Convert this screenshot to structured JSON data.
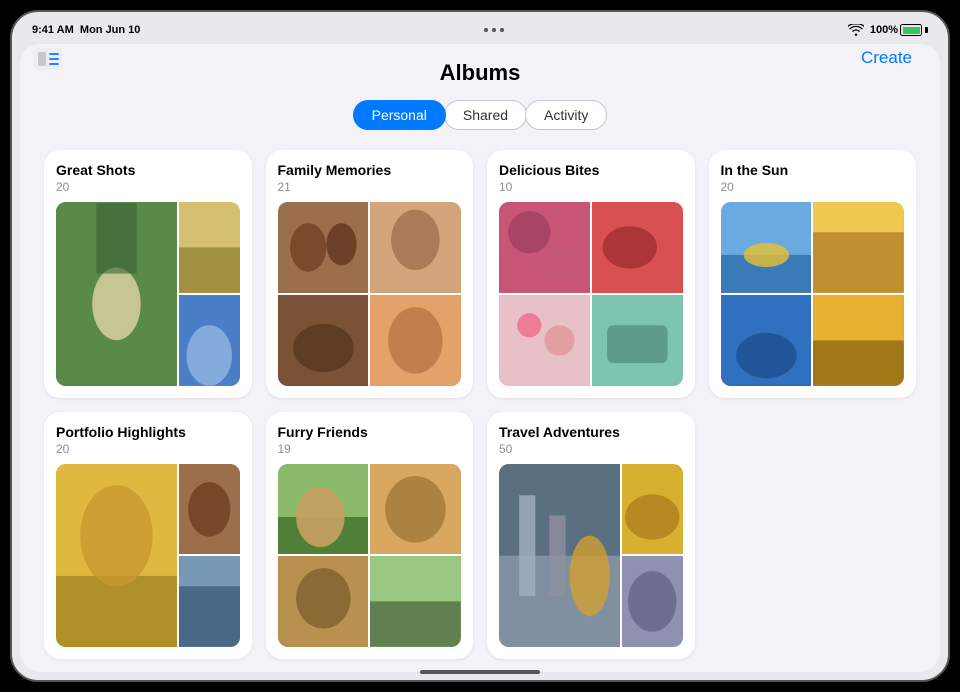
{
  "statusBar": {
    "time": "9:41 AM",
    "date": "Mon Jun 10",
    "battery": "100%"
  },
  "header": {
    "title": "Albums",
    "createLabel": "Create"
  },
  "tabs": [
    {
      "id": "personal",
      "label": "Personal",
      "active": true
    },
    {
      "id": "shared",
      "label": "Shared",
      "active": false
    },
    {
      "id": "activity",
      "label": "Activity",
      "active": false
    }
  ],
  "albums": [
    {
      "title": "Great Shots",
      "count": "20",
      "colors": [
        "#4a7c3f",
        "#c8b560",
        "#5b8dd9",
        "#8a6bbf",
        "#d4a832",
        "#c9874a"
      ]
    },
    {
      "title": "Family Memories",
      "count": "21",
      "colors": [
        "#8b5e3c",
        "#c4956a",
        "#6b4226",
        "#d4915a",
        "#a0723b",
        "#7d4e2a"
      ]
    },
    {
      "title": "Delicious Bites",
      "count": "10",
      "colors": [
        "#e85d7a",
        "#c94040",
        "#f0a0b0",
        "#d45060",
        "#6db5a0",
        "#e9c8d0"
      ]
    },
    {
      "title": "In the Sun",
      "count": "20",
      "colors": [
        "#4a8fce",
        "#e8b840",
        "#2060a8",
        "#d4a020",
        "#4888c0",
        "#e0c050"
      ]
    },
    {
      "title": "Portfolio Highlights",
      "count": "20",
      "colors": [
        "#d4a832",
        "#8b5e3c",
        "#c0c0c0",
        "#6888a8",
        "#e0d0a0",
        "#90a0c0"
      ]
    },
    {
      "title": "Furry Friends",
      "count": "19",
      "colors": [
        "#7aaa5a",
        "#c89850",
        "#a88040",
        "#8ab870",
        "#d4a060",
        "#b09050"
      ]
    },
    {
      "title": "Travel Adventures",
      "count": "50",
      "colors": [
        "#708090",
        "#e8c040",
        "#a080c0",
        "#d09030",
        "#8090a0",
        "#c0b050"
      ]
    }
  ]
}
